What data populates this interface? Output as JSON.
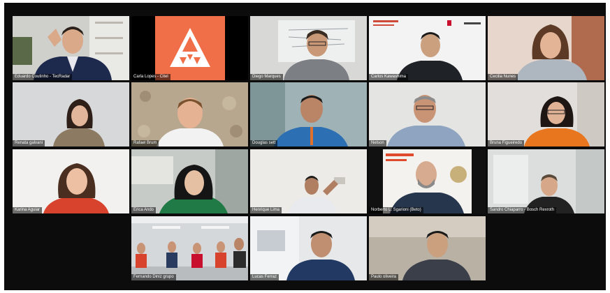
{
  "app": {
    "accent_logo_color": "#f06e48",
    "background_color": "#0c0c0c"
  },
  "participants": [
    {
      "name": "Eduardo Coutinho - TecRadar",
      "kind": "video"
    },
    {
      "name": "Carla Lopes - Citel",
      "kind": "logo",
      "icon": "triangle-logo-icon"
    },
    {
      "name": "Diego Marques",
      "kind": "video"
    },
    {
      "name": "Carlos Kawashima",
      "kind": "video"
    },
    {
      "name": "Cecilia Nunes",
      "kind": "video"
    },
    {
      "name": "Renata galvani",
      "kind": "video"
    },
    {
      "name": "Rafael Brum",
      "kind": "video"
    },
    {
      "name": "Douglas sett",
      "kind": "video"
    },
    {
      "name": "Nelson",
      "kind": "video"
    },
    {
      "name": "Bruna Figueiredo",
      "kind": "video"
    },
    {
      "name": "Karina Aguiar",
      "kind": "video"
    },
    {
      "name": "Erica Ando",
      "kind": "video"
    },
    {
      "name": "Henrique Lima",
      "kind": "video"
    },
    {
      "name": "Norberto L. Sgarioni (Beto)",
      "kind": "video"
    },
    {
      "name": "Sandro Chiaparro - Bosch Rexroth",
      "kind": "video"
    },
    {
      "name": "Fernando Diniz grupo",
      "kind": "video"
    },
    {
      "name": "Lucas Ferraz",
      "kind": "video"
    },
    {
      "name": "Paulo oliveira",
      "kind": "video"
    }
  ]
}
